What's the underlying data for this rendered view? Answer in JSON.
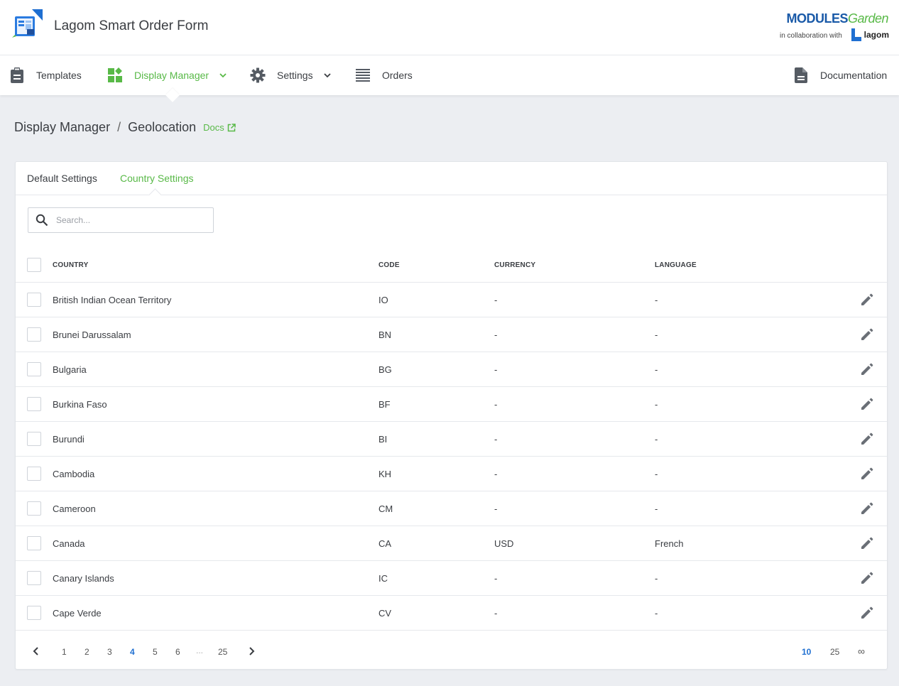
{
  "app": {
    "title": "Lagom Smart Order Form",
    "brand_modules": "MODULES",
    "brand_garden": "Garden",
    "brand_collab": "in collaboration with",
    "brand_lagom": "lagom"
  },
  "nav": {
    "templates": "Templates",
    "display_manager": "Display Manager",
    "settings": "Settings",
    "orders": "Orders",
    "documentation": "Documentation"
  },
  "breadcrumb": {
    "parent": "Display Manager",
    "separator": "/",
    "current": "Geolocation",
    "docs": "Docs"
  },
  "tabs": {
    "default": "Default Settings",
    "country": "Country Settings"
  },
  "search": {
    "placeholder": "Search..."
  },
  "table": {
    "headers": {
      "country": "COUNTRY",
      "code": "CODE",
      "currency": "CURRENCY",
      "language": "LANGUAGE"
    },
    "rows": [
      {
        "country": "British Indian Ocean Territory",
        "code": "IO",
        "currency": "-",
        "language": "-"
      },
      {
        "country": "Brunei Darussalam",
        "code": "BN",
        "currency": "-",
        "language": "-"
      },
      {
        "country": "Bulgaria",
        "code": "BG",
        "currency": "-",
        "language": "-"
      },
      {
        "country": "Burkina Faso",
        "code": "BF",
        "currency": "-",
        "language": "-"
      },
      {
        "country": "Burundi",
        "code": "BI",
        "currency": "-",
        "language": "-"
      },
      {
        "country": "Cambodia",
        "code": "KH",
        "currency": "-",
        "language": "-"
      },
      {
        "country": "Cameroon",
        "code": "CM",
        "currency": "-",
        "language": "-"
      },
      {
        "country": "Canada",
        "code": "CA",
        "currency": "USD",
        "language": "French"
      },
      {
        "country": "Canary Islands",
        "code": "IC",
        "currency": "-",
        "language": "-"
      },
      {
        "country": "Cape Verde",
        "code": "CV",
        "currency": "-",
        "language": "-"
      }
    ]
  },
  "pagination": {
    "pages": [
      "1",
      "2",
      "3",
      "4",
      "5",
      "6"
    ],
    "current_page": "4",
    "ellipsis": "...",
    "last": "25",
    "per_page": [
      "10",
      "25",
      "∞"
    ],
    "current_per_page": "10"
  },
  "colors": {
    "accent_green": "#58b947",
    "link_blue": "#1f6fd1",
    "brand_blue": "#1a5aa8"
  }
}
